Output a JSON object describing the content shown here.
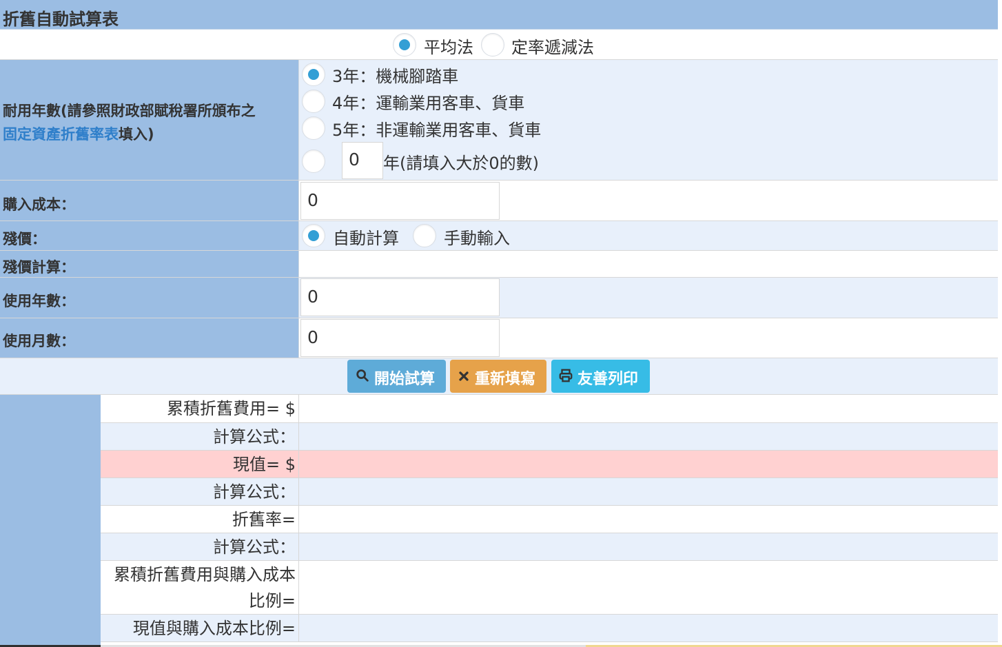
{
  "title": "折舊自動試算表",
  "method": {
    "options": [
      "平均法",
      "定率遞減法"
    ],
    "selected": "平均法"
  },
  "useful_life": {
    "label_prefix": "耐用年數(請參照財政部賦稅署所頒布之",
    "label_link": "固定資產折舊率表",
    "label_suffix": "填入)",
    "options": [
      "3年：機械腳踏車",
      "4年：運輸業用客車、貨車",
      "5年：非運輸業用客車、貨車"
    ],
    "selected_index": 0,
    "custom_value": "0",
    "custom_suffix": "年(請填入大於0的數)"
  },
  "purchase_cost": {
    "label": "購入成本：",
    "value": "0"
  },
  "salvage": {
    "label": "殘價：",
    "options": [
      "自動計算",
      "手動輸入"
    ],
    "selected": "自動計算"
  },
  "salvage_calc": {
    "label": "殘價計算："
  },
  "years_used": {
    "label": "使用年數：",
    "value": "0"
  },
  "months_used": {
    "label": "使用月數：",
    "value": "0"
  },
  "buttons": {
    "start": "開始試算",
    "reset": "重新填寫",
    "print": "友善列印"
  },
  "results": {
    "accumulated_depreciation": "累積折舊費用= $",
    "formula1": "計算公式：",
    "current_value": "現值= $",
    "formula2": "計算公式：",
    "depreciation_rate": "折舊率=",
    "formula3": "計算公式：",
    "accumulated_ratio": "累積折舊費用與購入成本比例=",
    "current_ratio": "現值與購入成本比例="
  },
  "colors": {
    "header_blue": "#9bbde3",
    "light_row": "#e8f0fb",
    "link_blue": "#2f7fca",
    "radio_blue": "#339fd5",
    "button_blue": "#5eabd8",
    "button_orange": "#e6a24a",
    "button_cyan": "#37bce6",
    "current_value_pink": "#ffd1d1"
  },
  "icons": {
    "start": "search-icon",
    "reset": "close-icon",
    "print": "print-icon"
  }
}
